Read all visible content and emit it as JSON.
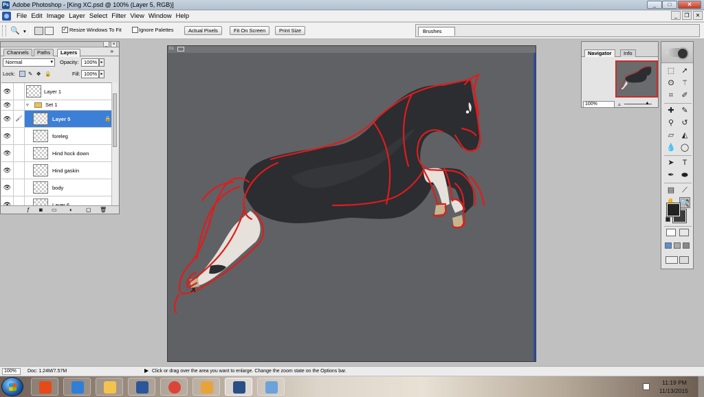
{
  "window": {
    "title": "Adobe Photoshop - [King XC.psd @ 100% (Layer 5, RGB)]",
    "app_icon": "Ps",
    "min_label": "_",
    "max_label": "□",
    "close_label": "✕"
  },
  "menu": {
    "items": [
      "File",
      "Edit",
      "Image",
      "Layer",
      "Select",
      "Filter",
      "View",
      "Window",
      "Help"
    ],
    "mdi_min": "_",
    "mdi_restore": "❐",
    "mdi_close": "✕"
  },
  "options": {
    "resize_label": "Resize Windows To Fit",
    "resize_checked": true,
    "ignore_label": "Ignore Palettes",
    "ignore_checked": false,
    "actual_pixels": "Actual Pixels",
    "fit_on_screen": "Fit On Screen",
    "print_size": "Print Size",
    "brushes_tab": "Brushes"
  },
  "document": {
    "tab_label": "01"
  },
  "layers_panel": {
    "tabs": [
      "Channels",
      "Paths",
      "Layers"
    ],
    "active_tab": "Layers",
    "more": "»",
    "blend_mode": "Normal",
    "opacity_label": "Opacity:",
    "opacity_value": "100%",
    "lock_label": "Lock:",
    "fill_label": "Fill:",
    "fill_value": "100%",
    "layers": [
      {
        "name": "Layer 1",
        "indent": false,
        "selected": false,
        "type": "layer"
      },
      {
        "name": "Set 1",
        "indent": false,
        "selected": false,
        "type": "set"
      },
      {
        "name": "Layer 5",
        "indent": true,
        "selected": true,
        "type": "layer"
      },
      {
        "name": "foreleg",
        "indent": true,
        "selected": false,
        "type": "layer"
      },
      {
        "name": "Hind hock down",
        "indent": true,
        "selected": false,
        "type": "layer"
      },
      {
        "name": "Hind gaskin",
        "indent": true,
        "selected": false,
        "type": "layer"
      },
      {
        "name": "body",
        "indent": true,
        "selected": false,
        "type": "layer"
      },
      {
        "name": "Layer 6",
        "indent": true,
        "selected": false,
        "type": "layer"
      }
    ]
  },
  "navigator_panel": {
    "tabs": [
      "Navigator",
      "Info"
    ],
    "active_tab": "Navigator",
    "zoom": "100%"
  },
  "toolbox": {
    "foreground_color": "#222222",
    "background_color": "#3b3b3b"
  },
  "status": {
    "zoom": "100%",
    "doc_info": "Doc: 1.24M/7.57M",
    "hint": "Click or drag over the area you want to enlarge. Change the zoom state on the Options bar."
  },
  "taskbar": {
    "apps": [
      "office-icon",
      "internet-explorer-icon",
      "file-explorer-icon",
      "word-icon",
      "chrome-icon",
      "notes-icon",
      "photoshop-icon",
      "paint-icon"
    ],
    "active_app": "photoshop-icon",
    "time": "11:19 PM",
    "date": "11/13/2015"
  },
  "colors": {
    "canvas_bg": "#5f6164",
    "workspace_bg": "#c0c0c0",
    "selection_blue": "#3c7fd6",
    "sketch_red": "#e21b1b",
    "horse_body": "#2b2d31"
  }
}
